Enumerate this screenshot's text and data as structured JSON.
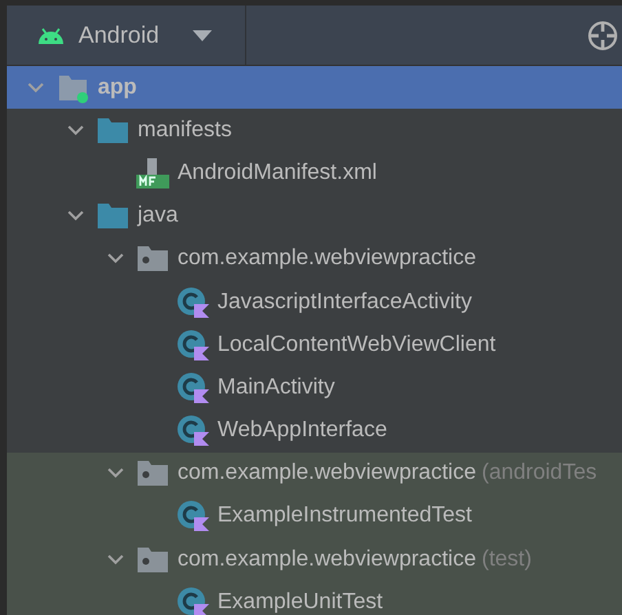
{
  "header": {
    "view": "Android"
  },
  "tree": [
    {
      "label": "app",
      "kind": "module",
      "selected": true,
      "expanded": true,
      "children": [
        {
          "label": "manifests",
          "kind": "folder",
          "selected": false,
          "expanded": true,
          "children": [
            {
              "label": "AndroidManifest.xml",
              "kind": "manifest",
              "selected": false
            }
          ]
        },
        {
          "label": "java",
          "kind": "folder",
          "selected": false,
          "expanded": true,
          "children": [
            {
              "label": "com.example.webviewpractice",
              "kind": "package",
              "selected": false,
              "expanded": true,
              "test": false,
              "children": [
                {
                  "label": "JavascriptInterfaceActivity",
                  "kind": "class",
                  "selected": false
                },
                {
                  "label": "LocalContentWebViewClient",
                  "kind": "class",
                  "selected": false
                },
                {
                  "label": "MainActivity",
                  "kind": "class",
                  "selected": false
                },
                {
                  "label": "WebAppInterface",
                  "kind": "class",
                  "selected": false
                }
              ]
            },
            {
              "label": "com.example.webviewpractice",
              "suffix": "(androidTes",
              "kind": "package",
              "selected": false,
              "expanded": true,
              "test": true,
              "children": [
                {
                  "label": "ExampleInstrumentedTest",
                  "kind": "class",
                  "selected": false
                }
              ]
            },
            {
              "label": "com.example.webviewpractice",
              "suffix": "(test)",
              "kind": "package",
              "selected": false,
              "expanded": true,
              "test": true,
              "children": [
                {
                  "label": "ExampleUnitTest",
                  "kind": "class",
                  "selected": false
                }
              ]
            }
          ]
        }
      ]
    }
  ]
}
